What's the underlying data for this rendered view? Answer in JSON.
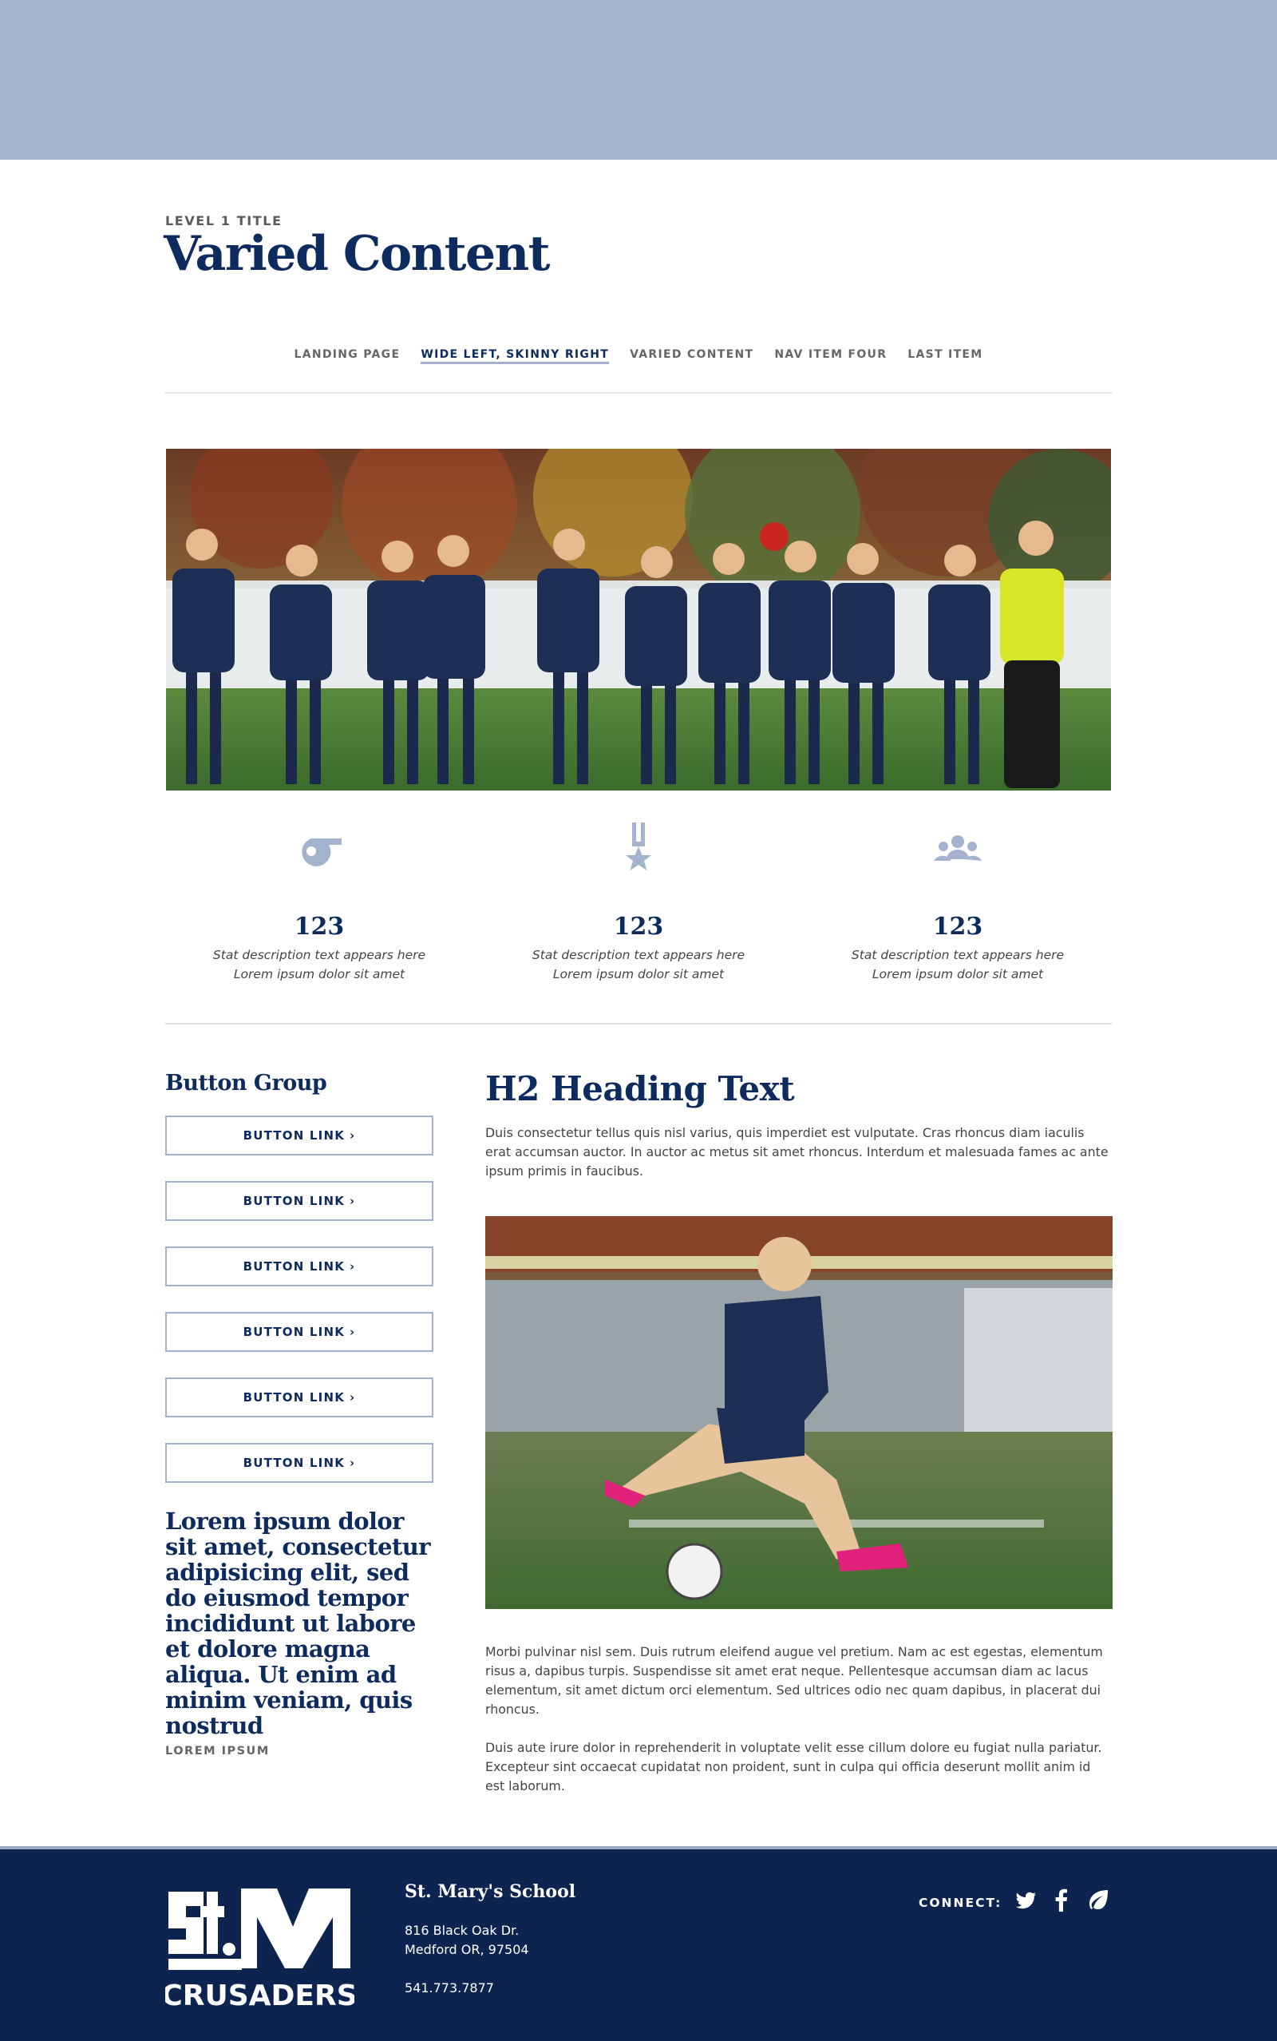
{
  "header": {
    "level_label": "LEVEL 1 TITLE",
    "title": "Varied Content"
  },
  "subnav": {
    "items": [
      {
        "label": "LANDING PAGE",
        "active": false
      },
      {
        "label": "WIDE LEFT, SKINNY RIGHT",
        "active": true
      },
      {
        "label": "VARIED CONTENT",
        "active": false
      },
      {
        "label": "NAV ITEM FOUR",
        "active": false
      },
      {
        "label": "LAST ITEM",
        "active": false
      }
    ]
  },
  "stats": [
    {
      "icon": "whistle-icon",
      "value": "123",
      "line1": "Stat description text appears here",
      "line2": "Lorem ipsum dolor sit amet"
    },
    {
      "icon": "medal-icon",
      "value": "123",
      "line1": "Stat description text appears here",
      "line2": "Lorem ipsum dolor sit amet"
    },
    {
      "icon": "group-icon",
      "value": "123",
      "line1": "Stat description text appears here",
      "line2": "Lorem ipsum dolor sit amet"
    }
  ],
  "sidebar": {
    "title": "Button Group",
    "buttons": [
      "BUTTON LINK",
      "BUTTON LINK",
      "BUTTON LINK",
      "BUTTON LINK",
      "BUTTON LINK",
      "BUTTON LINK"
    ],
    "quote": "Lorem ipsum dolor sit amet, consectetur adipisicing elit, sed do eiusmod tempor incididunt ut labore et dolore magna aliqua. Ut enim ad minim veniam, quis nostrud",
    "quote_attribution": "LOREM IPSUM"
  },
  "main": {
    "h2": "H2 Heading Text",
    "intro": "Duis consectetur tellus quis nisl varius, quis imperdiet est vulputate. Cras rhoncus diam iaculis erat accumsan auctor. In auctor ac metus sit amet rhoncus. Interdum et malesuada fames ac ante ipsum primis in faucibus.",
    "body1": "Morbi pulvinar nisl sem. Duis rutrum eleifend augue vel pretium. Nam ac est egestas, elementum risus a, dapibus turpis. Suspendisse sit amet erat neque. Pellentesque accumsan diam ac lacus elementum, sit amet dictum orci elementum. Sed ultrices odio nec quam dapibus, in placerat dui rhoncus.",
    "body2": "Duis aute irure dolor in reprehenderit in voluptate velit esse cillum dolore eu fugiat nulla pariatur. Excepteur sint occaecat cupidatat non proident, sunt in culpa qui officia deserunt mollit anim id est laborum."
  },
  "footer": {
    "logo_text": "St. M",
    "logo_subtext": "CRUSADERS",
    "school_name": "St. Mary's School",
    "address_line1": "816 Black Oak Dr.",
    "address_line2": "Medford OR, 97504",
    "phone": "541.773.7877",
    "connect_label": "CONNECT:",
    "social": [
      "twitter-icon",
      "facebook-icon",
      "leaf-icon"
    ]
  },
  "colors": {
    "navy": "#0d2b5e",
    "banner": "#a3b3cd",
    "footer_bg": "#0d2451"
  }
}
